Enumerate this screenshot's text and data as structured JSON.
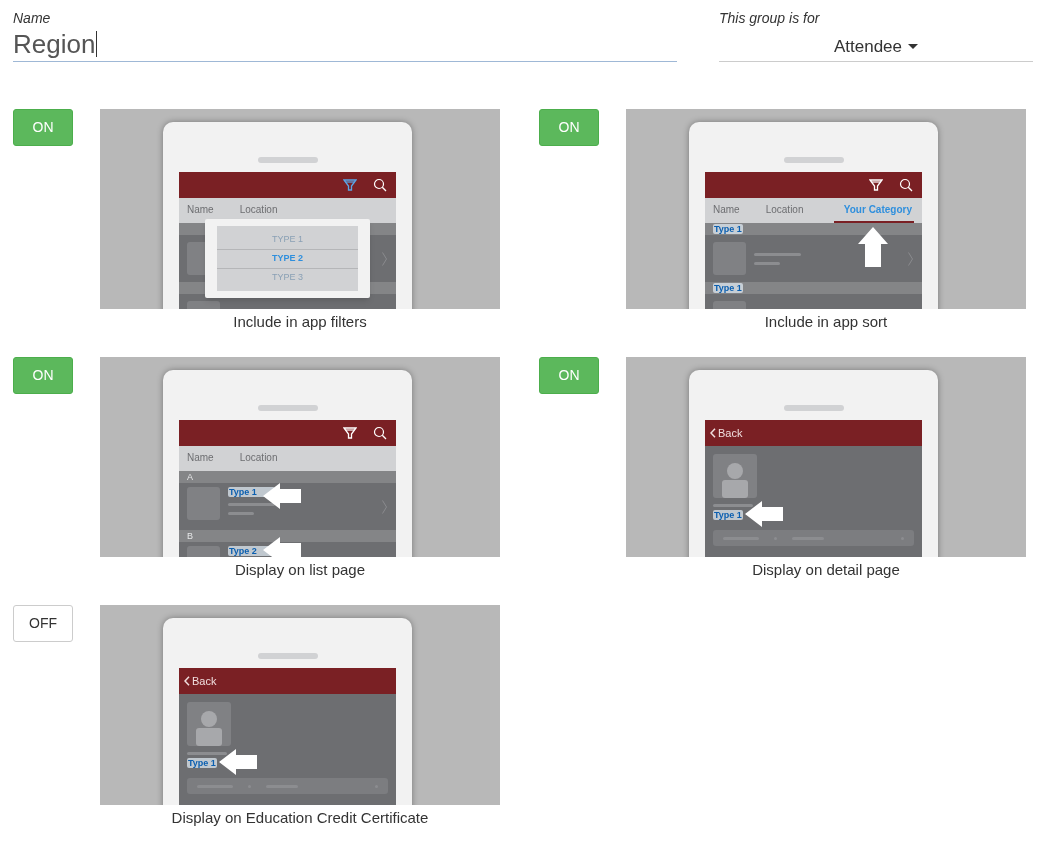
{
  "name_field": {
    "label": "Name",
    "value": "Region"
  },
  "group_for": {
    "label": "This group is for",
    "value": "Attendee"
  },
  "options": [
    {
      "on": true,
      "button": "ON",
      "caption": "Include in app filters",
      "mock": {
        "kind": "filter",
        "filter_active": true,
        "tabs": [
          {
            "label": "Name",
            "selected": false
          },
          {
            "label": "Location",
            "selected": false
          }
        ],
        "popup": [
          {
            "label": "TYPE 1",
            "selected": false
          },
          {
            "label": "TYPE 2",
            "selected": true
          },
          {
            "label": "TYPE 3",
            "selected": false
          }
        ]
      }
    },
    {
      "on": true,
      "button": "ON",
      "caption": "Include in app sort",
      "mock": {
        "kind": "sort",
        "filter_active": false,
        "tabs": [
          {
            "label": "Name",
            "selected": false
          },
          {
            "label": "Location",
            "selected": false
          },
          {
            "label": "Your Category",
            "selected": true
          }
        ],
        "sections": [
          "Type 1",
          "Type 1"
        ]
      }
    },
    {
      "on": true,
      "button": "ON",
      "caption": "Display on list page",
      "mock": {
        "kind": "list",
        "filter_active": false,
        "tabs": [
          {
            "label": "Name",
            "selected": false
          },
          {
            "label": "Location",
            "selected": false
          }
        ],
        "sections": [
          {
            "header": "A",
            "tag": "Type 1"
          },
          {
            "header": "B",
            "tag": "Type 2"
          }
        ]
      }
    },
    {
      "on": true,
      "button": "ON",
      "caption": "Display on detail page",
      "mock": {
        "kind": "detail",
        "back": "Back",
        "tag": "Type 1"
      }
    },
    {
      "on": false,
      "button": "OFF",
      "caption": "Display on Education Credit Certificate",
      "mock": {
        "kind": "detail",
        "back": "Back",
        "tag": "Type 1"
      }
    }
  ]
}
